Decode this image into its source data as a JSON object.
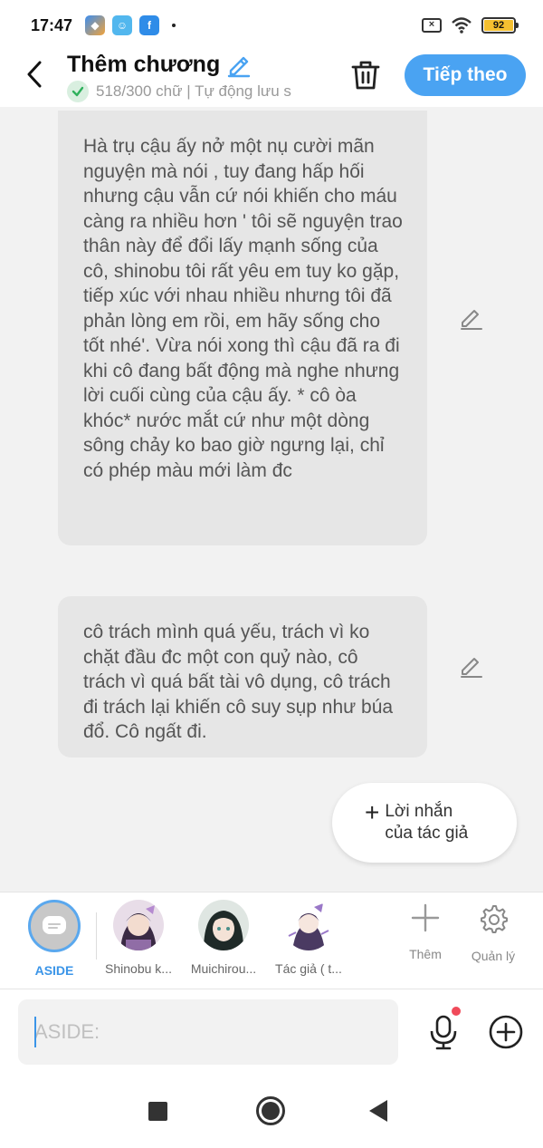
{
  "status_bar": {
    "time": "17:47",
    "app_icons": [
      "app-icon-1",
      "app-icon-2",
      "facebook-icon"
    ],
    "battery": "92"
  },
  "header": {
    "title": "Thêm chương",
    "subtitle": "518/300 chữ | Tự động lưu s",
    "next_label": "Tiếp theo"
  },
  "messages": [
    {
      "text": "Hà trụ cậu ấy nở một nụ cười mãn nguyện mà nói , tuy đang hấp hối nhưng cậu vẫn cứ nói khiến cho máu càng ra nhiều hơn ' tôi sẽ nguyện trao thân này để đổi lấy mạnh sống của cô, shinobu tôi rất yêu em tuy ko gặp, tiếp xúc với nhau nhiều nhưng tôi đã phản lòng em rồi, em hãy sống cho tốt nhé'. Vừa nói xong thì cậu đã ra đi khi cô đang bất động mà nghe nhưng lời cuối cùng của cậu ấy. * cô òa  khóc* nước mắt cứ như một dòng sông chảy ko bao giờ ngưng lại, chỉ có phép màu mới làm đc"
    },
    {
      "text": "cô trách mình quá yếu, trách vì ko chặt đầu đc một con quỷ nào, cô trách vì quá bất tài vô dụng, cô trách đi trách lại khiến cô suy sụp như búa đổ. Cô ngất đi."
    }
  ],
  "author_note_button": {
    "label": "Lời nhắn của tác giả"
  },
  "characters": {
    "aside": "ASIDE",
    "items": [
      {
        "label": "Shinobu k..."
      },
      {
        "label": "Muichirou..."
      },
      {
        "label": "Tác giả ( t..."
      }
    ],
    "add_label": "Thêm",
    "manage_label": "Quản lý"
  },
  "input": {
    "placeholder": "ASIDE:"
  },
  "colors": {
    "accent": "#4aa3f2",
    "bubble": "#e6e6e6",
    "notification_dot": "#f04a5a"
  }
}
